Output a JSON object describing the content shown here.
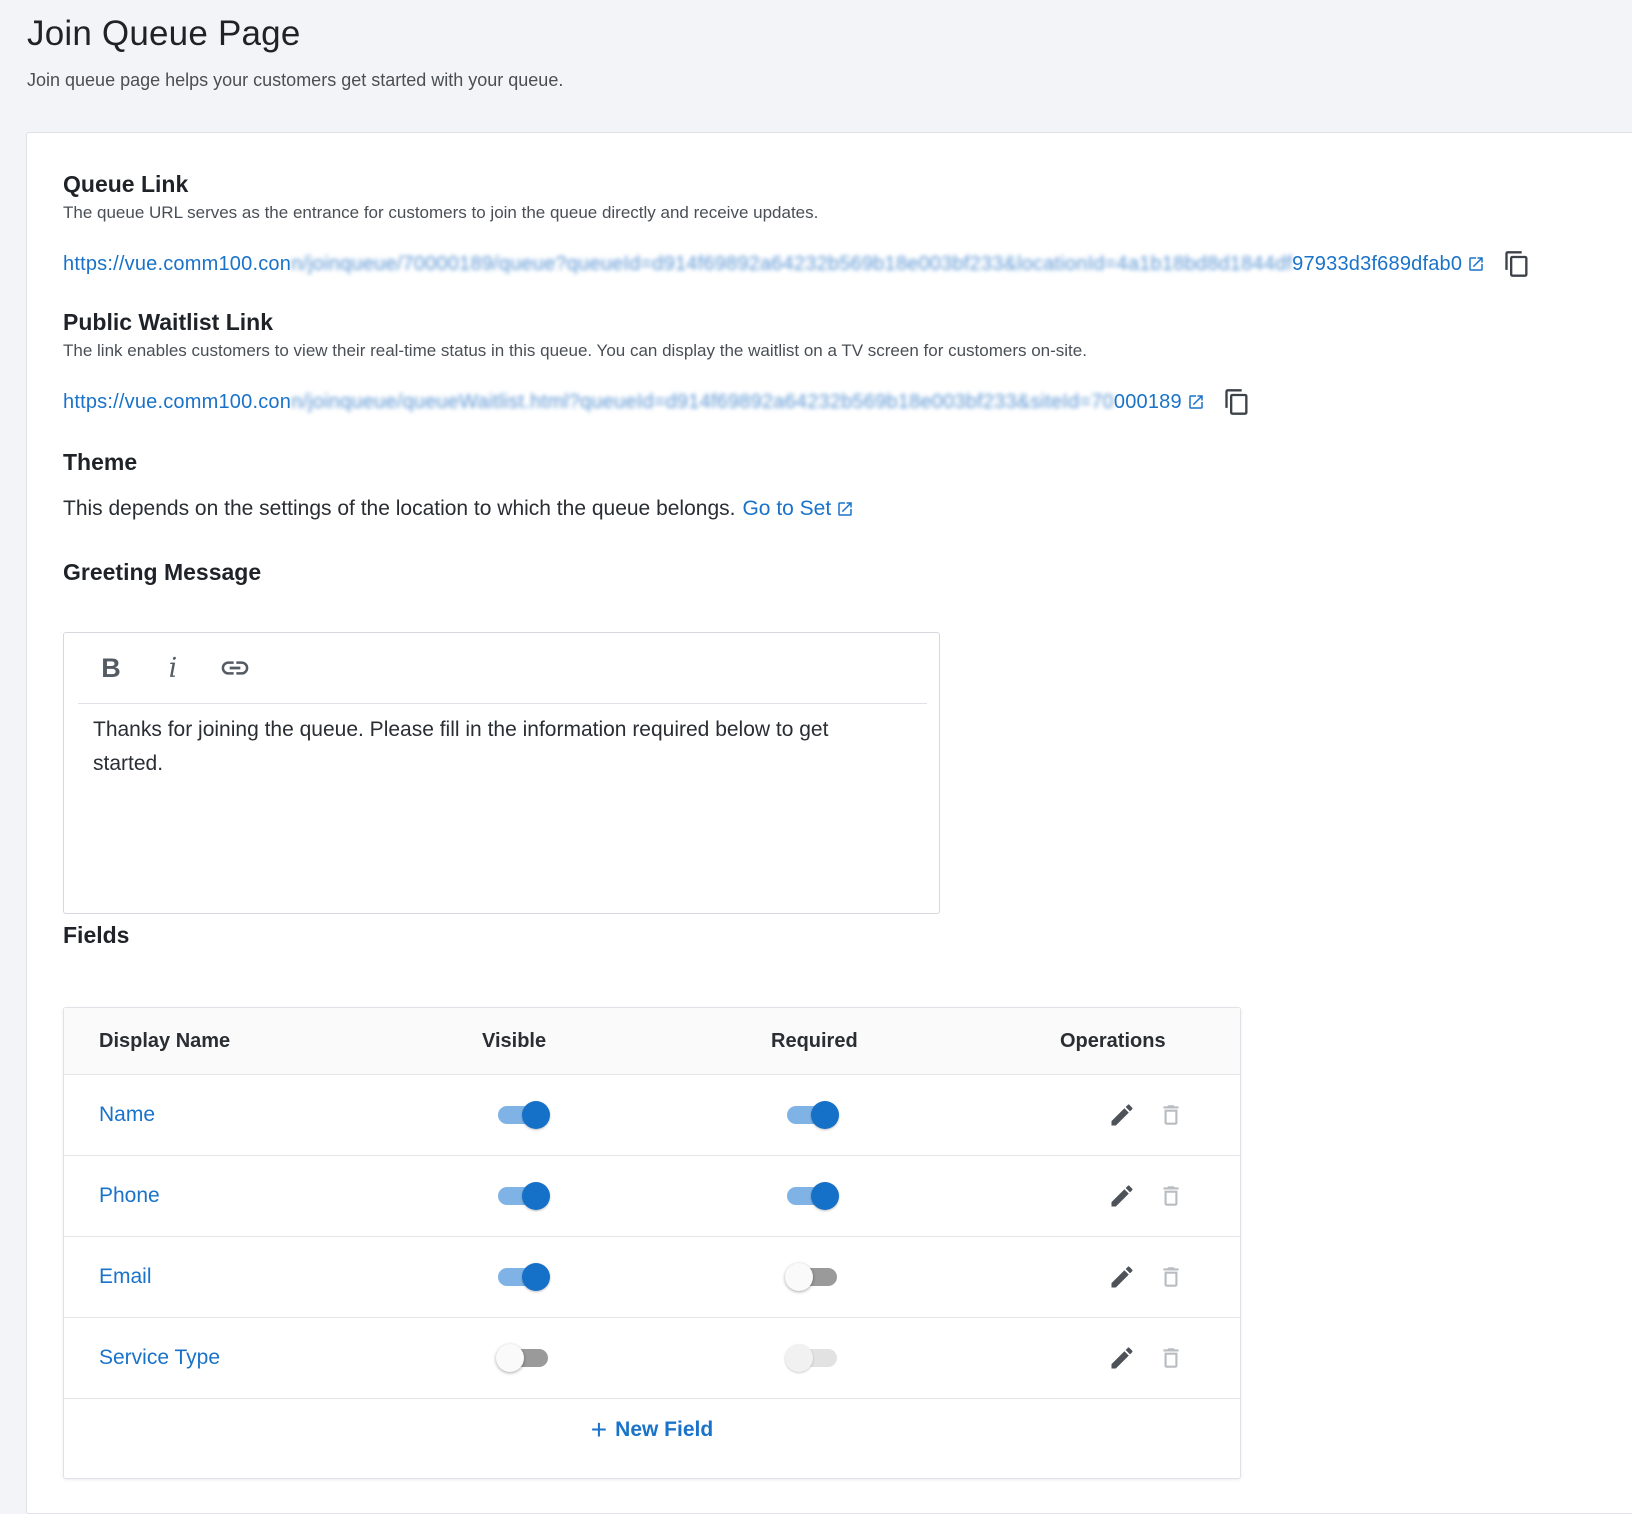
{
  "page": {
    "title": "Join Queue Page",
    "subtitle": "Join queue page helps your customers get started with your queue."
  },
  "queue_link": {
    "title": "Queue Link",
    "description": "The queue URL serves as the entrance for customers to join the queue directly and receive updates.",
    "url_visible_start": "https://vue.comm100.con",
    "url_blurred": "n/joinqueue/70000189/queue?queueId=d914f69892a64232b569b18e003bf233&locationId=4a1b18bd8d1844df",
    "url_visible_end": "97933d3f689dfab0",
    "open_icon": "external-link-icon",
    "copy_icon": "copy-icon"
  },
  "waitlist_link": {
    "title": "Public Waitlist Link",
    "description": "The link enables customers to view their real-time status in this queue. You can display the waitlist on a TV screen for customers on-site.",
    "url_visible_start": "https://vue.comm100.con",
    "url_blurred": "n/joinqueue/queueWaitlist.html?queueId=d914f69892a64232b569b18e003bf233&siteId=70",
    "url_visible_end": "000189",
    "open_icon": "external-link-icon",
    "copy_icon": "copy-icon"
  },
  "theme": {
    "title": "Theme",
    "text": "This depends on the settings of the location to which the queue belongs.",
    "link_label": "Go to Set"
  },
  "greeting": {
    "title": "Greeting Message",
    "toolbar": {
      "bold": "B",
      "italic": "i",
      "link_icon": "link-icon"
    },
    "body": "Thanks for joining the queue. Please fill in the information required below to get started."
  },
  "fields": {
    "title": "Fields",
    "headers": {
      "display_name": "Display Name",
      "visible": "Visible",
      "required": "Required",
      "operations": "Operations"
    },
    "rows": [
      {
        "name": "Name",
        "visible": "on",
        "required": "on"
      },
      {
        "name": "Phone",
        "visible": "on",
        "required": "on"
      },
      {
        "name": "Email",
        "visible": "on",
        "required": "off"
      },
      {
        "name": "Service Type",
        "visible": "off",
        "required": "disabled"
      }
    ],
    "new_field_label": "New Field"
  },
  "colors": {
    "accent": "#1a73c8",
    "switch_on_knob": "#1570c8",
    "switch_on_track": "#7fb3e6",
    "background": "#f3f4f7"
  }
}
